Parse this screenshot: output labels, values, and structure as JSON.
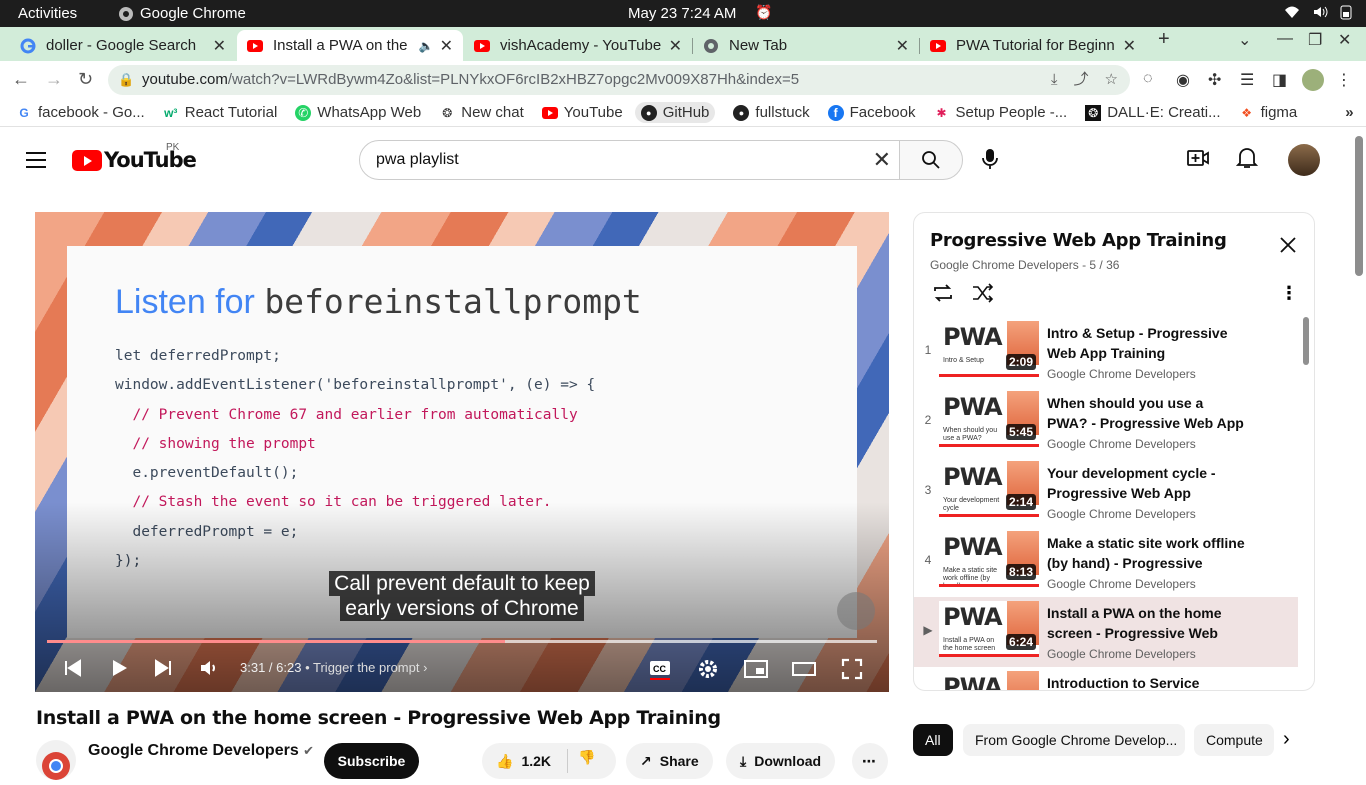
{
  "system": {
    "activities": "Activities",
    "app_name": "Google Chrome",
    "clock": "May 23  7:24 AM"
  },
  "tabs": [
    {
      "title": "doller - Google Search",
      "favicon": "google-icon",
      "active": false
    },
    {
      "title": "Install a PWA on the",
      "favicon": "youtube-icon",
      "active": true,
      "audio": true
    },
    {
      "title": "vishAcademy - YouTube",
      "favicon": "youtube-icon",
      "active": false
    },
    {
      "title": "New Tab",
      "favicon": "chrome-icon",
      "active": false
    },
    {
      "title": "PWA Tutorial for Beginn",
      "favicon": "youtube-icon",
      "active": false
    }
  ],
  "address": {
    "host": "youtube.com",
    "path": "/watch?v=LWRdBywm4Zo&list=PLNYkxOF6rcIB2xHBZ7opgc2Mv009X87Hh&index=5"
  },
  "bookmarks": [
    {
      "label": "facebook - Go...",
      "icon": "google-icon"
    },
    {
      "label": "React Tutorial",
      "icon": "w3schools-icon"
    },
    {
      "label": "WhatsApp Web",
      "icon": "whatsapp-icon"
    },
    {
      "label": "New chat",
      "icon": "openai-icon"
    },
    {
      "label": "YouTube",
      "icon": "youtube-icon"
    },
    {
      "label": "GitHub",
      "icon": "github-icon"
    },
    {
      "label": "fullstuck",
      "icon": "github-icon"
    },
    {
      "label": "Facebook",
      "icon": "facebook-icon"
    },
    {
      "label": "Setup People -...",
      "icon": "slack-icon"
    },
    {
      "label": "DALL·E: Creati...",
      "icon": "openai-icon"
    },
    {
      "label": "figma",
      "icon": "figma-icon"
    }
  ],
  "masthead": {
    "logo_text": "YouTube",
    "country": "PK",
    "search_query": "pwa playlist"
  },
  "player": {
    "slide_title_plain": "Listen for ",
    "slide_title_code": "beforeinstallprompt",
    "code_lines": [
      {
        "text": "let deferredPrompt;",
        "kind": "code"
      },
      {
        "text": "window.addEventListener('beforeinstallprompt', (e) => {",
        "kind": "code"
      },
      {
        "text": "  // Prevent Chrome 67 and earlier from automatically",
        "kind": "comment"
      },
      {
        "text": "  // showing the prompt",
        "kind": "comment"
      },
      {
        "text": "  e.preventDefault();",
        "kind": "code"
      },
      {
        "text": "  // Stash the event so it can be triggered later.",
        "kind": "comment"
      },
      {
        "text": "  deferredPrompt = e;",
        "kind": "code"
      },
      {
        "text": "});",
        "kind": "code"
      }
    ],
    "caption_line1": "Call prevent default to keep",
    "caption_line2": "early versions of Chrome",
    "time": "3:31 / 6:23",
    "chapter": "Trigger the prompt",
    "progress_fraction": 0.552
  },
  "video": {
    "title": "Install a PWA on the home screen - Progressive Web App Training",
    "channel": "Google Chrome Developers",
    "subscribe": "Subscribe",
    "likes": "1.2K",
    "share": "Share",
    "download": "Download"
  },
  "playlist": {
    "title": "Progressive Web App Training",
    "meta": "Google Chrome Developers - 5 / 36",
    "items": [
      {
        "index": "1",
        "title": "Intro & Setup - Progressive Web App Training",
        "channel": "Google Chrome Developers",
        "duration": "2:09",
        "thumb_text": "Intro & Setup"
      },
      {
        "index": "2",
        "title": "When should you use a PWA? - Progressive Web App Training",
        "channel": "Google Chrome Developers",
        "duration": "5:45",
        "thumb_text": "When should you use a PWA?"
      },
      {
        "index": "3",
        "title": "Your development cycle - Progressive Web App Training",
        "channel": "Google Chrome Developers",
        "duration": "2:14",
        "thumb_text": "Your development cycle"
      },
      {
        "index": "4",
        "title": "Make a static site work offline (by hand) - Progressive Web…",
        "channel": "Google Chrome Developers",
        "duration": "8:13",
        "thumb_text": "Make a static site work offline (by hand)"
      },
      {
        "index": "▶",
        "title": "Install a PWA on the home screen - Progressive Web Ap…",
        "channel": "Google Chrome Developers",
        "duration": "6:24",
        "thumb_text": "Install a PWA on the home screen",
        "current": true
      },
      {
        "index": "",
        "title": "Introduction to Service Worker",
        "channel": "",
        "duration": "",
        "thumb_text": ""
      }
    ]
  },
  "chips": [
    "All",
    "From Google Chrome Develop...",
    "Compute"
  ]
}
